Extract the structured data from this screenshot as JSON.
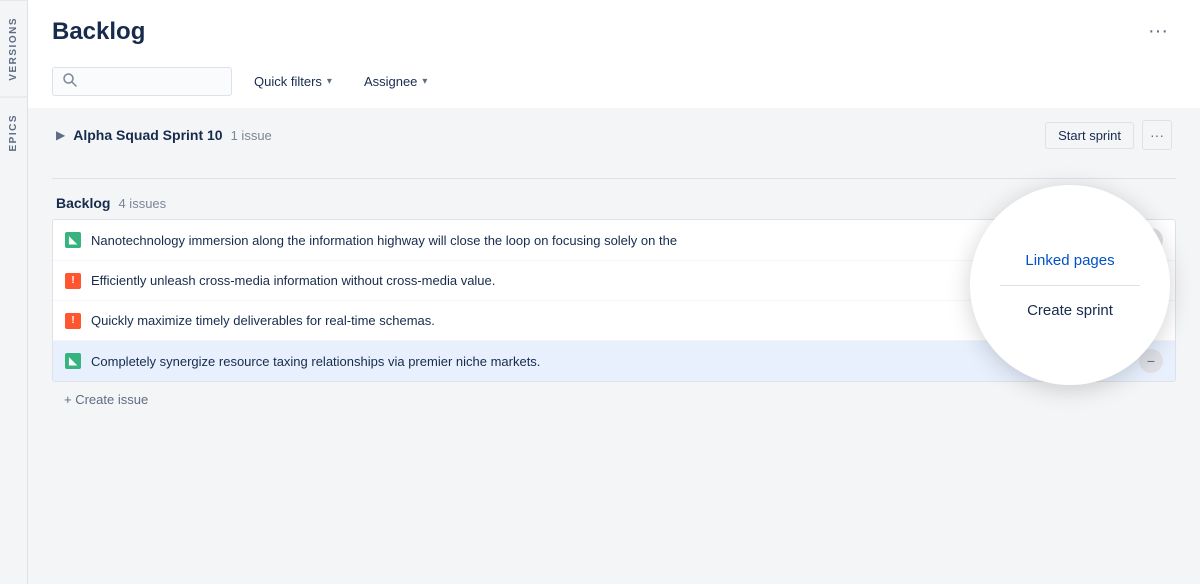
{
  "header": {
    "title": "Backlog",
    "more_icon": "···"
  },
  "toolbar": {
    "search_placeholder": "",
    "quick_filters_label": "Quick filters",
    "assignee_label": "Assignee"
  },
  "side_tabs": [
    {
      "id": "versions",
      "label": "VERSIONS"
    },
    {
      "id": "epics",
      "label": "EPICS"
    }
  ],
  "sprint": {
    "name": "Alpha Squad Sprint 10",
    "count_label": "1 issue",
    "start_sprint_label": "Start sprint",
    "more_icon": "···"
  },
  "backlog": {
    "title": "Backlog",
    "count_label": "4 issues",
    "create_issue_label": "+ Create issue"
  },
  "context_menu": {
    "linked_pages_label": "Linked pages",
    "create_sprint_label": "Create sprint"
  },
  "issues": [
    {
      "id": "SB-9",
      "type": "story",
      "text": "Nanotechnology immersion along the information highway will close the loop on focusing solely on the",
      "has_priority": true,
      "has_action": true,
      "highlighted": false
    },
    {
      "id": "SB-10",
      "type": "bug",
      "text": "Efficiently unleash cross-media information without cross-media value.",
      "has_priority": true,
      "has_action": false,
      "highlighted": false
    },
    {
      "id": "SB-11",
      "type": "bug",
      "text": "Quickly maximize timely deliverables for real-time schemas.",
      "has_priority": true,
      "has_action": false,
      "highlighted": false
    },
    {
      "id": "SB-12",
      "type": "story",
      "text": "Completely synergize resource taxing relationships via premier niche markets.",
      "has_priority": true,
      "has_action": true,
      "highlighted": true
    }
  ]
}
